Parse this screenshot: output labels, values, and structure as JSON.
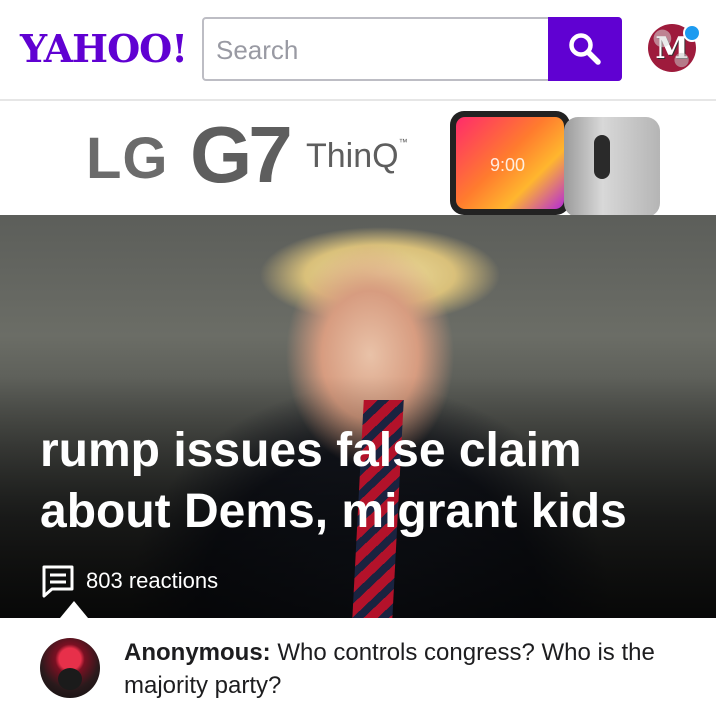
{
  "header": {
    "logo": "YAHOO!",
    "search": {
      "placeholder": "Search",
      "value": ""
    }
  },
  "ad": {
    "brand": "LG",
    "model": "G7",
    "suffix": "ThinQ",
    "trademark": "™",
    "phone_time": "9:00"
  },
  "hero": {
    "headline": "rump issues false claim about Dems, migrant kids",
    "reactions": "803 reactions"
  },
  "comment": {
    "author": "Anonymous:",
    "text": " Who controls congress? Who is the majority party?"
  },
  "colors": {
    "brand": "#6001d2",
    "notification": "#1d9bf0"
  },
  "icons": [
    "search-icon",
    "comment-icon"
  ]
}
